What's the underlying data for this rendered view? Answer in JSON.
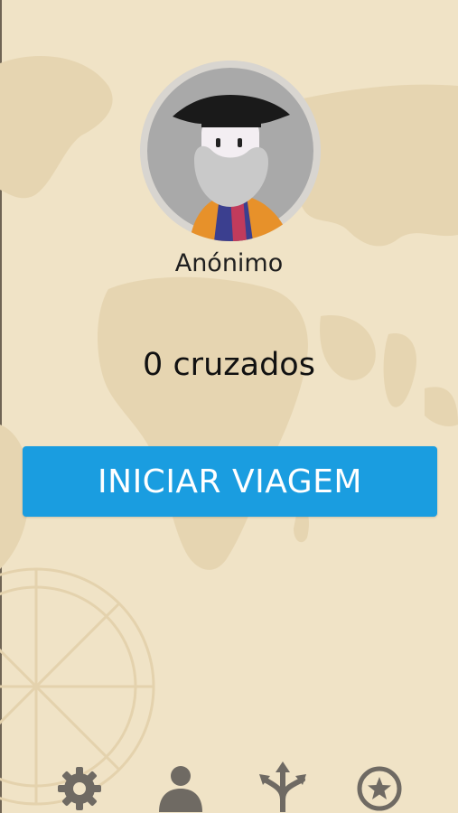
{
  "profile": {
    "avatar_icon": "explorer-portrait-icon",
    "name": "Anónimo"
  },
  "wallet": {
    "coins_text": "0 cruzados"
  },
  "actions": {
    "start_label": "INICIAR VIAGEM"
  },
  "nav": {
    "items": [
      {
        "icon": "gear-icon"
      },
      {
        "icon": "user-icon"
      },
      {
        "icon": "split-arrows-icon"
      },
      {
        "icon": "star-medal-icon"
      }
    ]
  },
  "colors": {
    "background": "#f0e3c6",
    "accent": "#1a9de0",
    "nav_icon": "#6f6a63"
  }
}
